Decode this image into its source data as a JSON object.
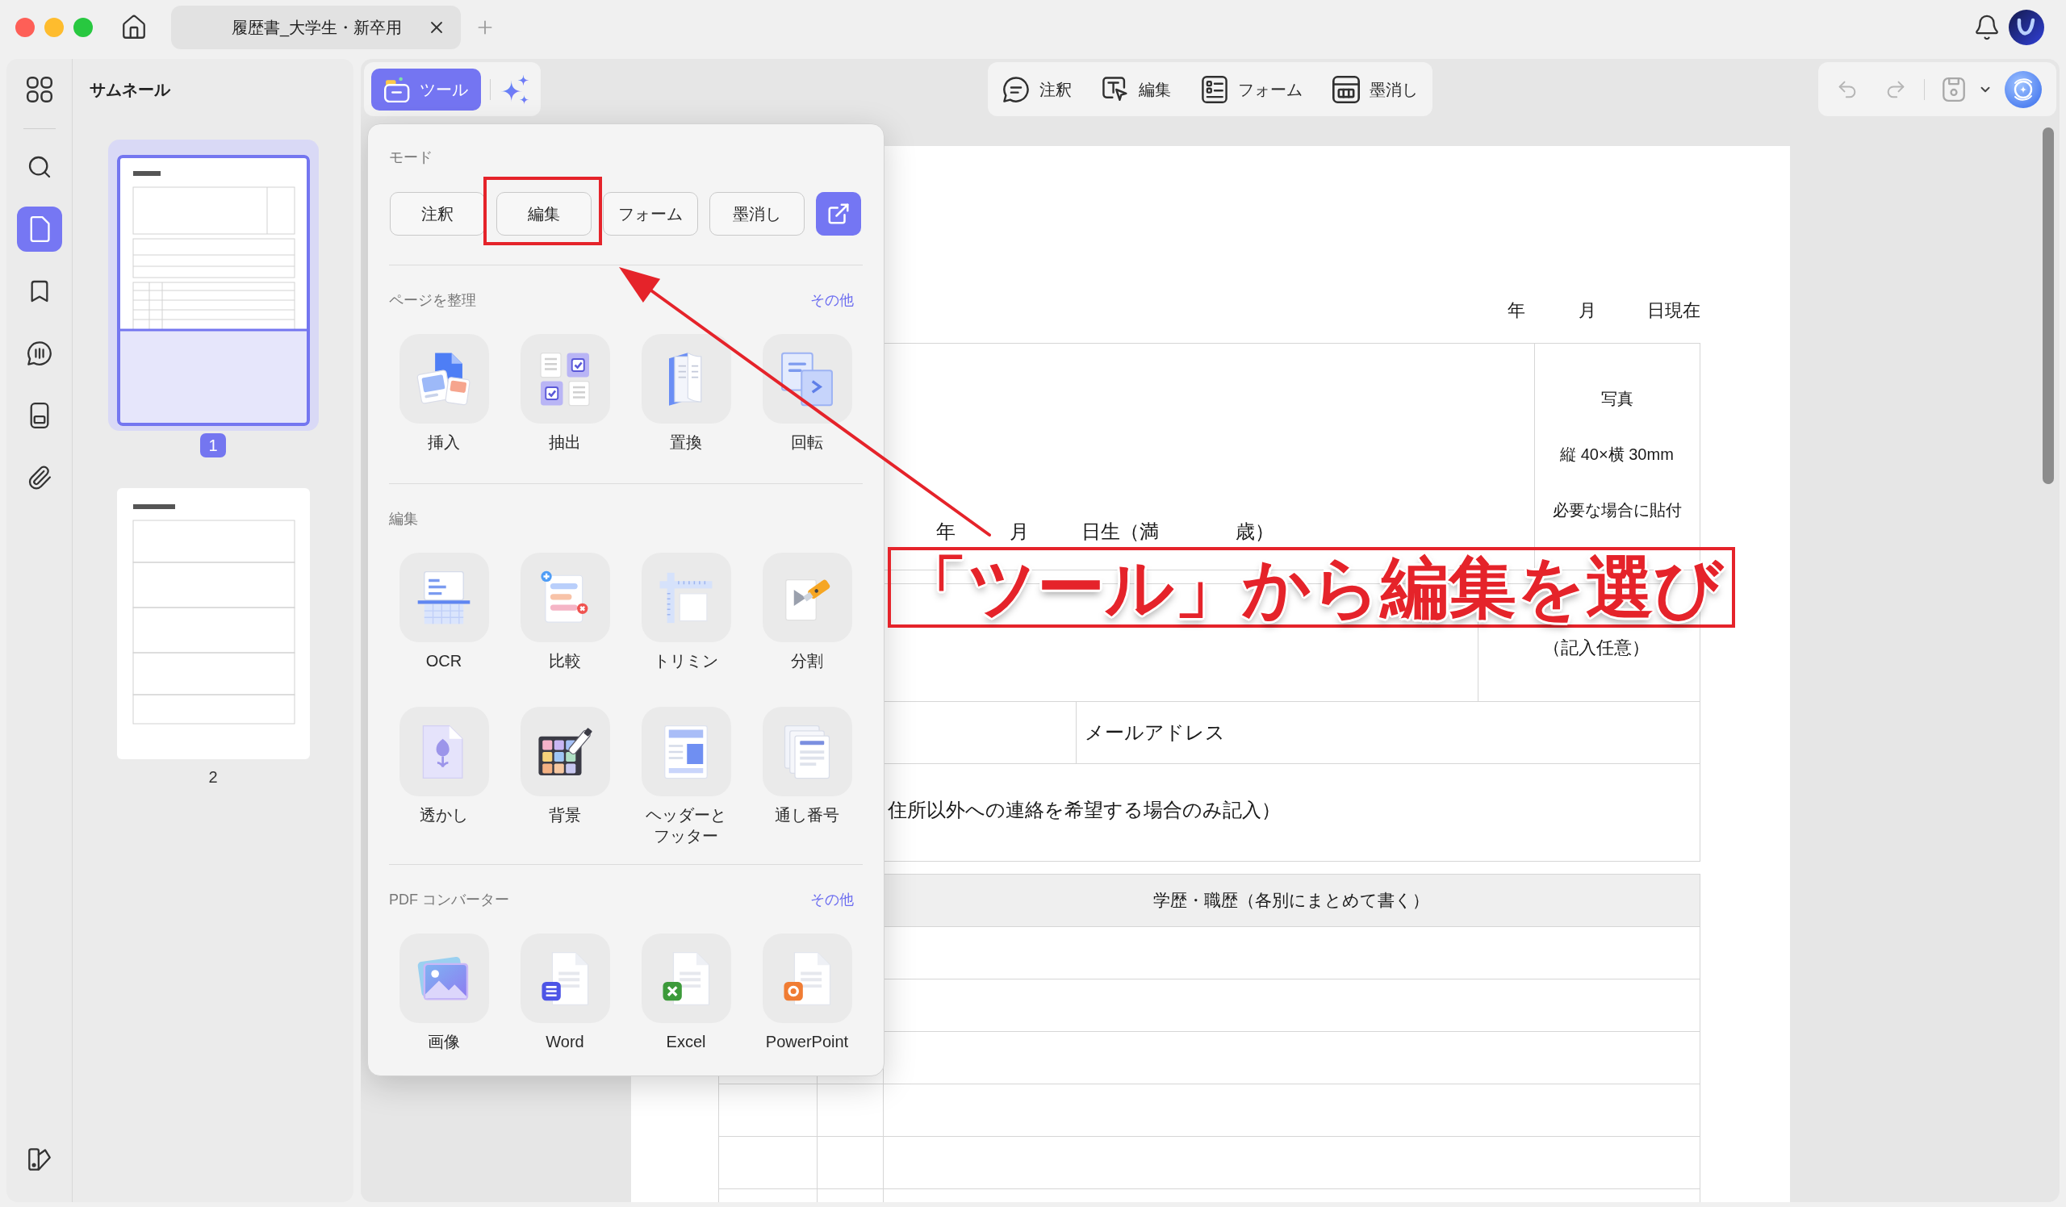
{
  "window": {
    "tab": {
      "title": "履歴書_大学生・新卒用"
    }
  },
  "sidebar": {
    "rail": [
      {
        "selected": false
      },
      {
        "selected": false
      },
      {
        "selected": true
      },
      {
        "selected": false
      },
      {
        "selected": false
      },
      {
        "selected": false
      },
      {
        "selected": false
      }
    ],
    "panel_title": "サムネール",
    "pages": [
      {
        "number": "1",
        "selected": true
      },
      {
        "number": "2",
        "selected": false
      }
    ]
  },
  "toolbar": {
    "tools": {
      "label": "ツール",
      "selected": true
    },
    "modes": [
      {
        "label": "注釈"
      },
      {
        "label": "編集"
      },
      {
        "label": "フォーム"
      },
      {
        "label": "墨消し"
      }
    ],
    "undo": {
      "disabled": true
    },
    "redo": {
      "disabled": true
    }
  },
  "tools_menu": {
    "mode_title": "モード",
    "modes": [
      {
        "label": "注釈"
      },
      {
        "label": "編集"
      },
      {
        "label": "フォーム"
      },
      {
        "label": "墨消し"
      }
    ],
    "sections": [
      {
        "title": "ページを整理",
        "more": "その他",
        "items": [
          {
            "label": "挿入"
          },
          {
            "label": "抽出"
          },
          {
            "label": "置換"
          },
          {
            "label": "回転"
          }
        ]
      },
      {
        "title": "編集",
        "items": [
          {
            "label": "OCR"
          },
          {
            "label": "比較"
          },
          {
            "label": "トリミン"
          },
          {
            "label": "分割"
          },
          {
            "label": "透かし"
          },
          {
            "label": "背景"
          },
          {
            "label": "ヘッダーとフッター"
          },
          {
            "label": "通し番号"
          }
        ]
      },
      {
        "title": "PDF コンバーター",
        "more": "その他",
        "items": [
          {
            "label": "画像"
          },
          {
            "label": "Word"
          },
          {
            "label": "Excel"
          },
          {
            "label": "PowerPoint"
          }
        ]
      }
    ]
  },
  "document": {
    "date_line": [
      "年",
      "月",
      "日現在"
    ],
    "birth_line": [
      "年",
      "月",
      "日生（満",
      "歳）"
    ],
    "photo_box": [
      "写真",
      "縦 40×横 30mm",
      "必要な場合に貼付"
    ],
    "gender_note": "（記入任意）",
    "email_label": "メールアドレス",
    "contact_note": "住所以外への連絡を希望する場合のみ記入）",
    "history_header": "学歴・職歴（各別にまとめて書く）"
  },
  "annotation": {
    "caption": "「ツール」から編集を選び"
  }
}
